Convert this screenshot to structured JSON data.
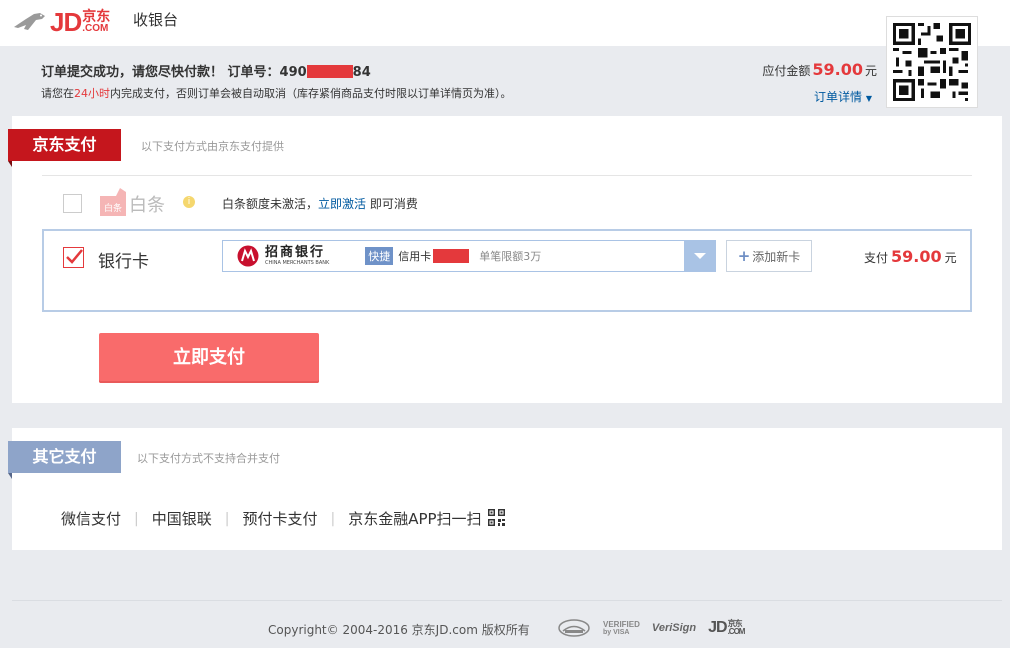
{
  "header": {
    "logo_text": "JD",
    "logo_cn": "京东",
    "logo_com": ".COM",
    "title": "收银台"
  },
  "order": {
    "submit_text": "订单提交成功，请您尽快付款！ 订单号：",
    "order_prefix": "490",
    "order_suffix": "84",
    "tip_prefix": "请您在",
    "tip_hours": "24小时",
    "tip_suffix": "内完成支付，否则订单会被自动取消（库存紧俏商品支付时限以订单详情页为准）。",
    "amount_label": "应付金额",
    "amount_value": "59.00",
    "amount_unit": "元",
    "detail_link": "订单详情"
  },
  "jd_pay": {
    "ribbon": "京东支付",
    "subtitle": "以下支付方式由京东支付提供",
    "baitiao": {
      "icon_label": "白条",
      "name": "白条",
      "desc_prefix": "白条额度未激活，",
      "activate_link": "立即激活",
      "desc_suffix": " 即可消费"
    },
    "bank": {
      "name": "银行卡",
      "bank_logo_cn": "招商银行",
      "bank_logo_en": "CHINA MERCHANTS BANK",
      "quick_badge": "快捷",
      "card_type": "信用卡",
      "limit": "单笔限额3万",
      "add_card": "添加新卡",
      "pay_label": "支付",
      "pay_value": "59.00",
      "pay_unit": "元"
    },
    "pay_button": "立即支付"
  },
  "other_pay": {
    "ribbon": "其它支付",
    "subtitle": "以下支付方式不支持合并支付",
    "options": [
      "微信支付",
      "中国银联",
      "预付卡支付",
      "京东金融APP扫一扫"
    ]
  },
  "footer": {
    "copyright": "Copyright© 2004-2016 京东JD.com 版权所有",
    "badge_verified_top": "VERIFIED",
    "badge_verified_mid": "by VISA",
    "badge_verisign": "VeriSign",
    "badge_jd": "JD",
    "badge_jd_cn": "京东",
    "badge_jd_com": ".COM"
  }
}
